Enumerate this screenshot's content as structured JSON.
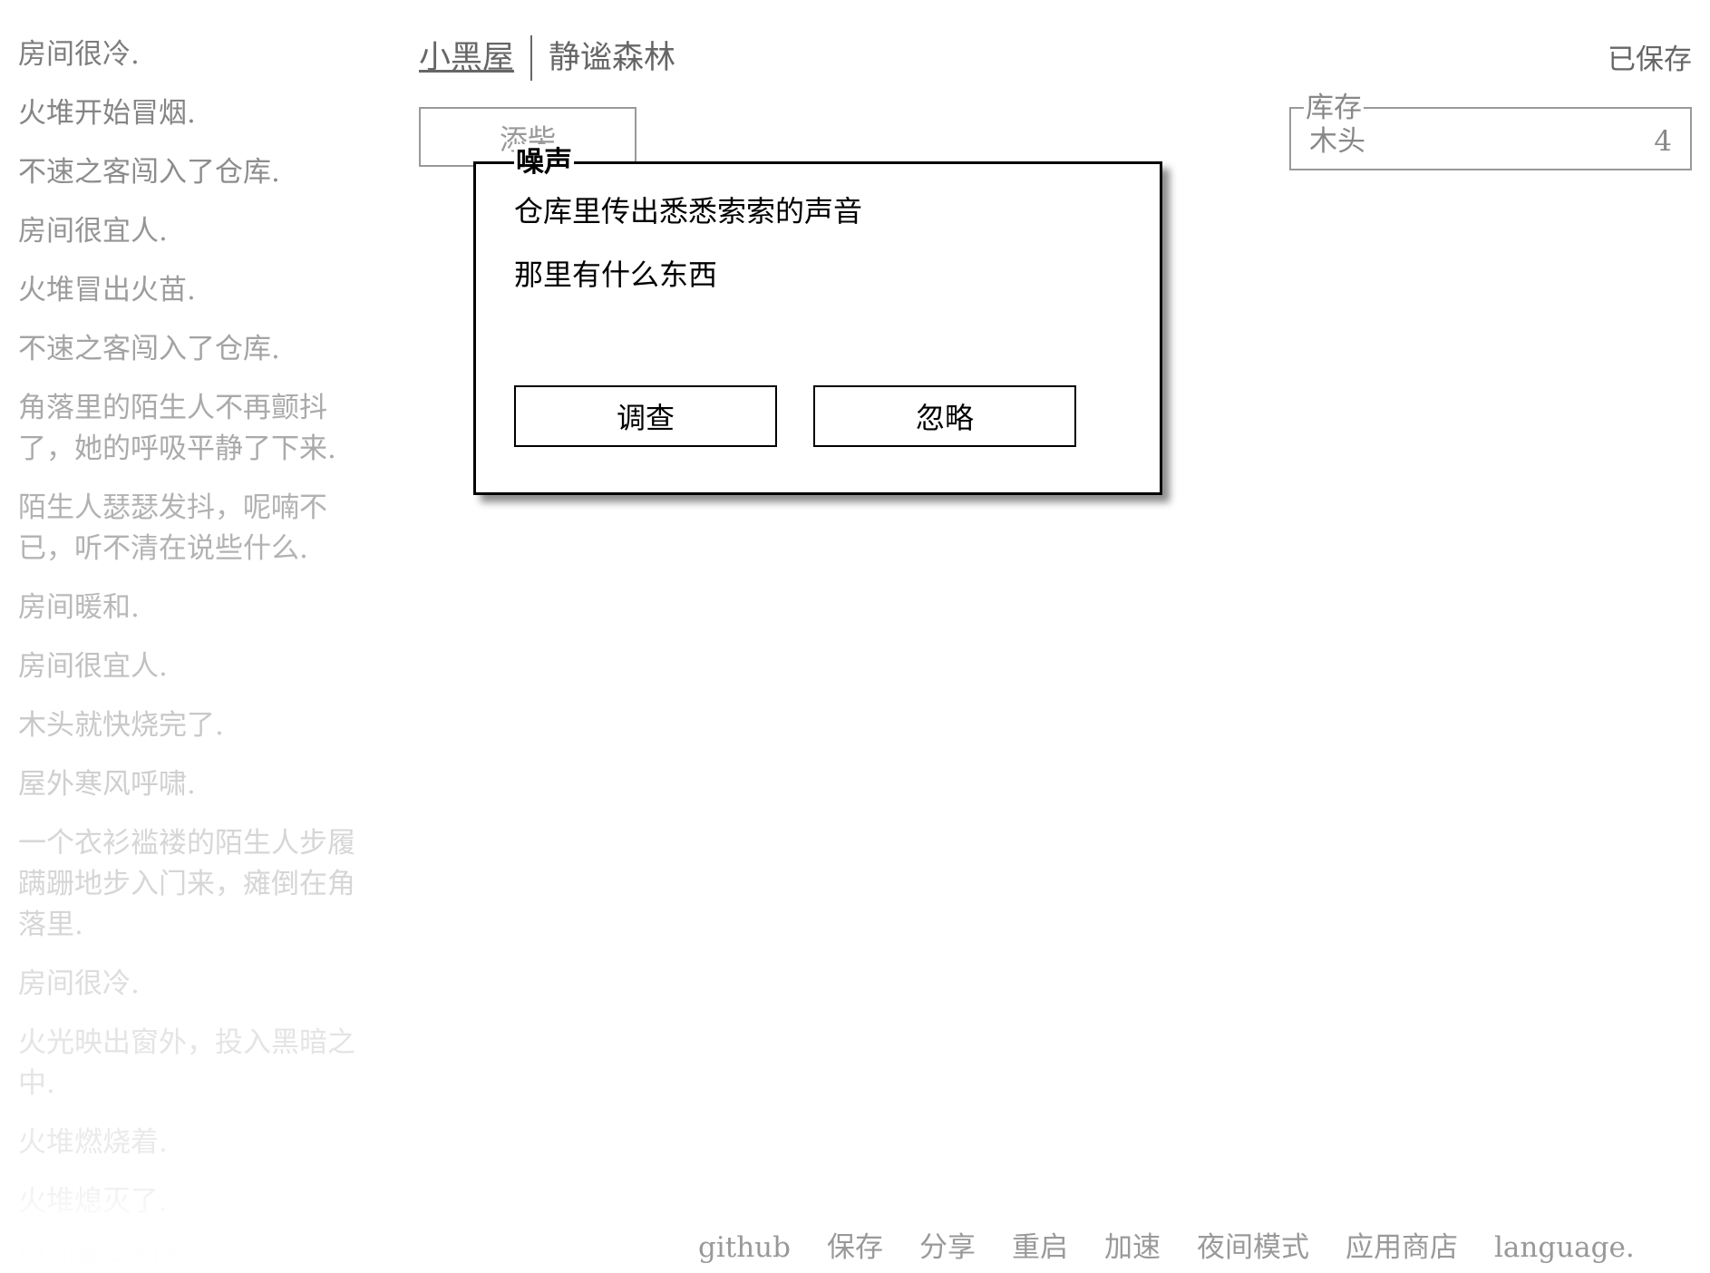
{
  "notifications": [
    {
      "text": "房间很冷.",
      "color": "#7d7d7d"
    },
    {
      "text": "火堆开始冒烟.",
      "color": "#858585"
    },
    {
      "text": "不速之客闯入了仓库.",
      "color": "#8d8d8d"
    },
    {
      "text": "房间很宜人.",
      "color": "#959595"
    },
    {
      "text": "火堆冒出火苗.",
      "color": "#9c9c9c"
    },
    {
      "text": "不速之客闯入了仓库.",
      "color": "#a3a3a3"
    },
    {
      "text": "角落里的陌生人不再颤抖了，她的呼吸平静了下来.",
      "color": "#aaaaaa"
    },
    {
      "text": "陌生人瑟瑟发抖，呢喃不已，听不清在说些什么.",
      "color": "#b2b2b2"
    },
    {
      "text": "房间暖和.",
      "color": "#b9b9b9"
    },
    {
      "text": "房间很宜人.",
      "color": "#c1c1c1"
    },
    {
      "text": "木头就快烧完了.",
      "color": "#c8c8c8"
    },
    {
      "text": "屋外寒风呼啸.",
      "color": "#cfcfcf"
    },
    {
      "text": "一个衣衫褴褛的陌生人步履蹒跚地步入门来，瘫倒在角落里.",
      "color": "#d6d6d6"
    },
    {
      "text": "房间很冷.",
      "color": "#dddddd"
    },
    {
      "text": "火光映出窗外，投入黑暗之中.",
      "color": "#e4e4e4"
    },
    {
      "text": "火堆燃烧着.",
      "color": "#eaeaea"
    },
    {
      "text": "火堆熄灭了.",
      "color": "#efefef"
    },
    {
      "text": "房间寒冷刺骨.",
      "color": "#f3f3f3"
    }
  ],
  "header": {
    "tabs": [
      {
        "label": "小黑屋",
        "selected": true
      },
      {
        "label": "静谧森林",
        "selected": false
      }
    ],
    "save_status": "已保存"
  },
  "actions": {
    "stoke_label": "添柴"
  },
  "stores": {
    "legend": "库存",
    "items": [
      {
        "name": "木头",
        "count": "4"
      }
    ]
  },
  "event": {
    "title": "噪声",
    "lines": [
      "仓库里传出悉悉索索的声音",
      "那里有什么东西"
    ],
    "buttons": {
      "investigate": "调查",
      "ignore": "忽略"
    }
  },
  "footer": {
    "links": [
      "github",
      "保存",
      "分享",
      "重启",
      "加速",
      "夜间模式",
      "应用商店",
      "language."
    ]
  }
}
